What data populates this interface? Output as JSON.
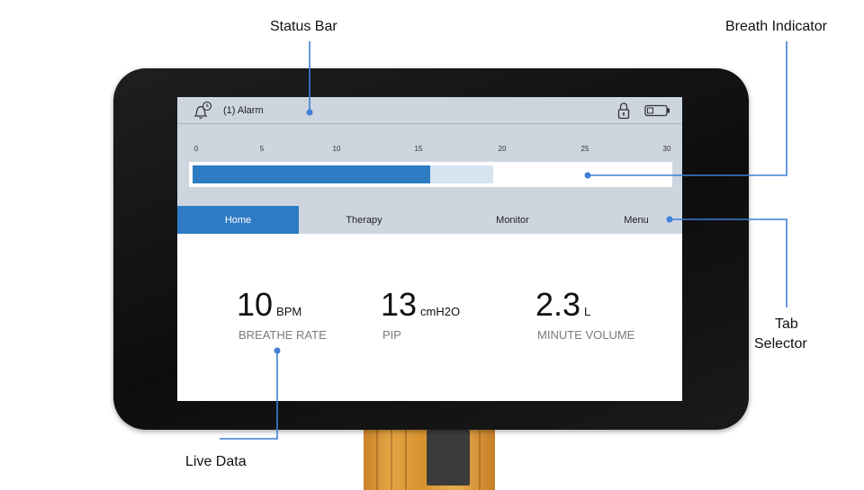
{
  "annotations": {
    "status_bar": "Status Bar",
    "breath_indicator": "Breath Indicator",
    "tab_selector_line1": "Tab",
    "tab_selector_line2": "Selector",
    "live_data": "Live Data"
  },
  "status_bar": {
    "alarm_text": "(1) Alarm",
    "icons": [
      "alarm-bell-icon",
      "lock-icon",
      "battery-icon"
    ]
  },
  "breath_indicator": {
    "scale": [
      "0",
      "5",
      "10",
      "15",
      "20",
      "25",
      "30"
    ],
    "scale_max": 30,
    "filled_value": 15,
    "range_value": 19,
    "fill_color": "#2e7bc4",
    "range_color": "#d6e3f0"
  },
  "tabs": [
    {
      "label": "Home",
      "active": true
    },
    {
      "label": "Therapy",
      "active": false
    },
    {
      "label": "Monitor",
      "active": false
    },
    {
      "label": "Menu",
      "active": false
    }
  ],
  "live_data": [
    {
      "value": "10",
      "unit": "BPM",
      "label": "BREATHE RATE"
    },
    {
      "value": "13",
      "unit": "cmH2O",
      "label": "PIP"
    },
    {
      "value": "2.3",
      "unit": "L",
      "label": "MINUTE VOLUME"
    }
  ],
  "colors": {
    "accent": "#2e7bc4",
    "panel": "#cdd5df",
    "leader_line": "#3f7fd6"
  }
}
